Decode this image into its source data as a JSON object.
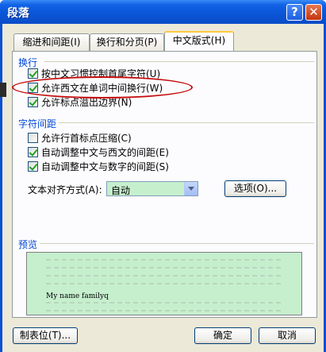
{
  "window": {
    "title": "段落",
    "help_glyph": "?",
    "close_glyph": "✕"
  },
  "tabs": [
    {
      "label": "缩进和间距(I)"
    },
    {
      "label": "换行和分页(P)"
    },
    {
      "label": "中文版式(H)"
    }
  ],
  "line_break": {
    "heading": "换行",
    "options": [
      {
        "label": "按中文习惯控制首尾字符(U)",
        "checked": true
      },
      {
        "label": "允许西文在单词中间换行(W)",
        "checked": true
      },
      {
        "label": "允许标点溢出边界(N)",
        "checked": true
      }
    ]
  },
  "char_spacing": {
    "heading": "字符间距",
    "options": [
      {
        "label": "允许行首标点压缩(C)",
        "checked": false
      },
      {
        "label": "自动调整中文与西文的间距(E)",
        "checked": true
      },
      {
        "label": "自动调整中文与数字的间距(S)",
        "checked": true
      }
    ]
  },
  "alignment": {
    "label": "文本对齐方式(A):",
    "value": "自动",
    "options_button": "选项(O)..."
  },
  "preview": {
    "heading": "预览",
    "sample_text": "My name familyq"
  },
  "footer": {
    "tabs_button": "制表位(T)...",
    "ok_button": "确定",
    "cancel_button": "取消"
  },
  "colors": {
    "title_bar": "#0a54d6",
    "preview_bg": "#c6efce",
    "highlight_oval": "#c40d0d",
    "group_label": "#0046d5"
  }
}
